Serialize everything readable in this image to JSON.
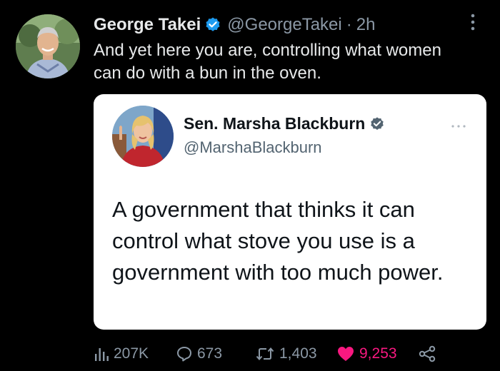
{
  "author": {
    "display_name": "George Takei",
    "handle": "@GeorgeTakei",
    "separator": "·",
    "time": "2h",
    "verified": true
  },
  "tweet": {
    "text": "And yet here you are, controlling what women can do with a bun in the oven."
  },
  "quote": {
    "display_name": "Sen. Marsha Blackburn",
    "handle": "@MarshaBlackburn",
    "verified": true,
    "text": "A government that thinks it can control what stove you use is a government with too much power."
  },
  "actions": {
    "views": "207K",
    "replies": "673",
    "retweets": "1,403",
    "likes": "9,253"
  },
  "icons": {
    "verified": "verified-badge-icon",
    "more": "more-options-icon",
    "views": "analytics-bars-icon",
    "replies": "reply-bubble-icon",
    "retweets": "retweet-arrows-icon",
    "likes": "heart-filled-icon",
    "share": "share-nodes-icon"
  },
  "colors": {
    "background": "#000000",
    "text_primary": "#e7e9ea",
    "text_secondary": "#8b98a5",
    "verified_blue": "#1d9bf0",
    "like_pink": "#f91880",
    "quote_background": "#ffffff"
  }
}
